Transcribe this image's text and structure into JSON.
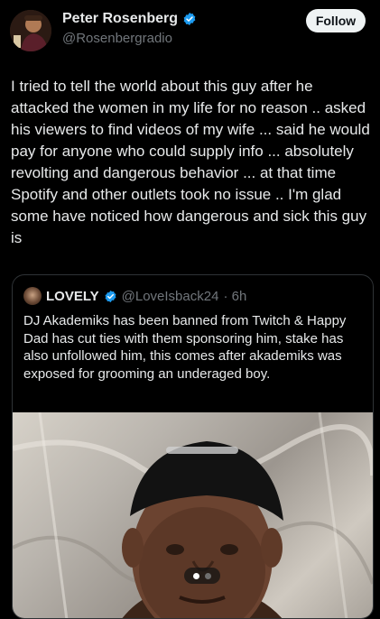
{
  "tweet": {
    "author_name": "Peter Rosenberg",
    "author_handle": "@Rosenbergradio",
    "follow_label": "Follow",
    "text": "I tried to tell the world about this guy after he attacked the women in my life for no reason .. asked his viewers to find videos of my wife ... said he would pay for anyone who could supply info ... absolutely revolting and dangerous behavior ... at that time Spotify and other outlets took no issue .. I'm glad some have noticed how dangerous and sick this guy is"
  },
  "quoted_tweet": {
    "author_name": "LOVELY",
    "author_handle": "@LoveIsback24",
    "time": "· 6h",
    "text": "DJ Akademiks has been banned from Twitch & Happy Dad has cut ties with them sponsoring him, stake has also unfollowed him, this comes after akademiks was exposed for grooming an underaged boy.",
    "media_pages": 2,
    "media_current_page": 1
  },
  "colors": {
    "background": "#000000",
    "text": "#e7e9ea",
    "secondary_text": "#71767b",
    "verified_blue": "#1d9bf0",
    "follow_bg": "#eff3f4",
    "border": "#2f3336"
  },
  "icons": {
    "verified": "verified-badge-icon"
  }
}
